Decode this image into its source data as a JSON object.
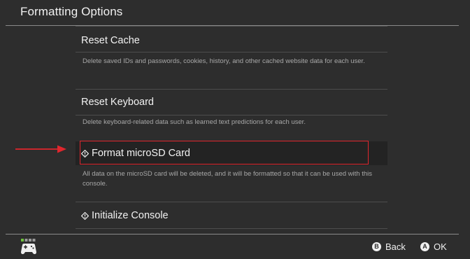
{
  "header": {
    "title": "Formatting Options"
  },
  "items": [
    {
      "title": "Reset Cache",
      "description": "Delete saved IDs and passwords, cookies, history, and other cached website data for each user."
    },
    {
      "title": "Reset Keyboard",
      "description": "Delete keyboard-related data such as learned text predictions for each user."
    },
    {
      "title": "Format microSD Card",
      "icon": "diamond-alert-icon",
      "selected": true,
      "description": "All data on the microSD card will be deleted, and it will be formatted so that it can be used with this console."
    },
    {
      "title": "Initialize Console",
      "icon": "diamond-alert-icon"
    }
  ],
  "footer": {
    "controller_icon": "controller-icon",
    "back_glyph": "B",
    "back_label": "Back",
    "ok_glyph": "A",
    "ok_label": "OK"
  },
  "annotations": {
    "highlight_color": "#e0262d",
    "arrow_color": "#e0262d"
  }
}
